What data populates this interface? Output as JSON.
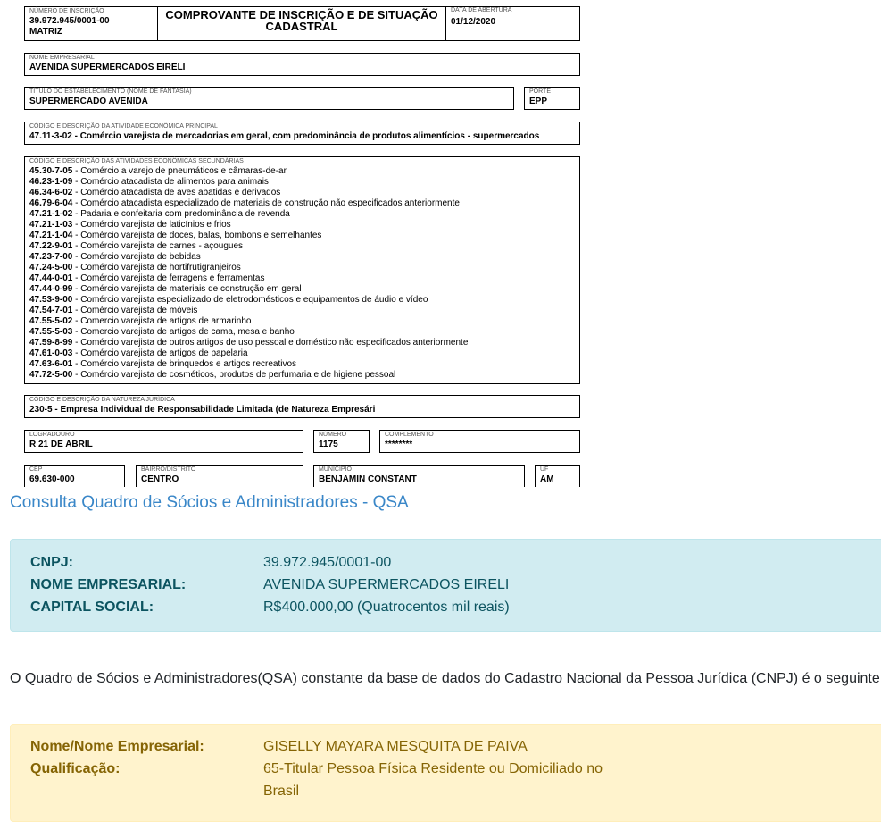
{
  "document": {
    "inscricao_caption": "NÚMERO DE INSCRIÇÃO",
    "inscricao_number": "39.972.945/0001-00",
    "inscricao_type": "MATRIZ",
    "title_line1": "COMPROVANTE DE INSCRIÇÃO E DE SITUAÇÃO",
    "title_line2": "CADASTRAL",
    "abertura_caption": "DATA DE ABERTURA",
    "abertura_date": "01/12/2020",
    "nome_caption": "NOME EMPRESARIAL",
    "nome_value": "AVENIDA SUPERMERCADOS EIRELI",
    "fantasia_caption": "TÍTULO DO ESTABELECIMENTO (NOME DE FANTASIA)",
    "fantasia_value": "SUPERMERCADO AVENIDA",
    "porte_caption": "PORTE",
    "porte_value": "EPP",
    "principal_caption": "CÓDIGO E DESCRIÇÃO DA ATIVIDADE ECONÔMICA PRINCIPAL",
    "principal_code": "47.11-3-02",
    "principal_desc": " - Comércio varejista de mercadorias em geral, com predominância de produtos alimentícios - supermercados",
    "secundarias_caption": "CÓDIGO E DESCRIÇÃO DAS ATIVIDADES ECONÔMICAS SECUNDÁRIAS",
    "secundarias": [
      {
        "code": "45.30-7-05",
        "desc": " - Comércio a varejo de pneumáticos e câmaras-de-ar"
      },
      {
        "code": "46.23-1-09",
        "desc": " - Comércio atacadista de alimentos para animais"
      },
      {
        "code": "46.34-6-02",
        "desc": " - Comércio atacadista de aves abatidas e derivados"
      },
      {
        "code": "46.79-6-04",
        "desc": " - Comércio atacadista especializado de materiais de construção não especificados anteriormente"
      },
      {
        "code": "47.21-1-02",
        "desc": " - Padaria e confeitaria com predominância de revenda"
      },
      {
        "code": "47.21-1-03",
        "desc": " - Comércio varejista de laticínios e frios"
      },
      {
        "code": "47.21-1-04",
        "desc": " - Comércio varejista de doces, balas, bombons e semelhantes"
      },
      {
        "code": "47.22-9-01",
        "desc": " - Comércio varejista de carnes - açougues"
      },
      {
        "code": "47.23-7-00",
        "desc": " - Comércio varejista de bebidas"
      },
      {
        "code": "47.24-5-00",
        "desc": " - Comércio varejista de hortifrutigranjeiros"
      },
      {
        "code": "47.44-0-01",
        "desc": " - Comércio varejista de ferragens e ferramentas"
      },
      {
        "code": "47.44-0-99",
        "desc": " - Comércio varejista de materiais de construção em geral"
      },
      {
        "code": "47.53-9-00",
        "desc": " - Comércio varejista especializado de eletrodomésticos e equipamentos de áudio e vídeo"
      },
      {
        "code": "47.54-7-01",
        "desc": " - Comércio varejista de móveis"
      },
      {
        "code": "47.55-5-02",
        "desc": " - Comercio varejista de artigos de armarinho"
      },
      {
        "code": "47.55-5-03",
        "desc": " - Comercio varejista de artigos de cama, mesa e banho"
      },
      {
        "code": "47.59-8-99",
        "desc": " - Comércio varejista de outros artigos de uso pessoal e doméstico não especificados anteriormente"
      },
      {
        "code": "47.61-0-03",
        "desc": " - Comércio varejista de artigos de papelaria"
      },
      {
        "code": "47.63-6-01",
        "desc": " - Comércio varejista de brinquedos e artigos recreativos"
      },
      {
        "code": "47.72-5-00",
        "desc": " - Comércio varejista de cosméticos, produtos de perfumaria e de higiene pessoal"
      }
    ],
    "natureza_caption": "CÓDIGO E DESCRIÇÃO DA NATUREZA JURÍDICA",
    "natureza_value": "230-5 - Empresa Individual de Responsabilidade Limitada (de Natureza Empresári",
    "logradouro_caption": "LOGRADOURO",
    "logradouro_value": "R 21 DE ABRIL",
    "numero_caption": "NÚMERO",
    "numero_value": "1175",
    "complemento_caption": "COMPLEMENTO",
    "complemento_value": "********",
    "cep_caption": "CEP",
    "cep_value": "69.630-000",
    "bairro_caption": "BAIRRO/DISTRITO",
    "bairro_value": "CENTRO",
    "municipio_caption": "MUNICÍPIO",
    "municipio_value": "BENJAMIN CONSTANT",
    "uf_caption": "UF",
    "uf_value": "AM"
  },
  "qsa": {
    "heading": "Consulta Quadro de Sócios e Administradores - QSA",
    "cnpj_label": "CNPJ:",
    "cnpj_value": "39.972.945/0001-00",
    "nome_label": "NOME EMPRESARIAL:",
    "nome_value": "AVENIDA SUPERMERCADOS EIRELI",
    "capital_label": "CAPITAL SOCIAL:",
    "capital_value": "R$400.000,00 (Quatrocentos mil reais)",
    "intro": "O Quadro de Sócios e Administradores(QSA) constante da base de dados do Cadastro Nacional da Pessoa Jurídica (CNPJ) é o seguinte:",
    "partner_name_label": "Nome/Nome Empresarial:",
    "partner_name_value": "GISELLY MAYARA MESQUITA DE PAIVA",
    "qualificacao_label": "Qualificação:",
    "qualificacao_line1": "65-Titular Pessoa Física Residente ou Domiciliado no",
    "qualificacao_line2": "Brasil"
  },
  "colors": {
    "heading": "#3a87c8",
    "info_bg": "#d1ecf1",
    "info_text": "#0c5460",
    "warning_bg": "#fff3cd",
    "warning_text": "#856404"
  }
}
